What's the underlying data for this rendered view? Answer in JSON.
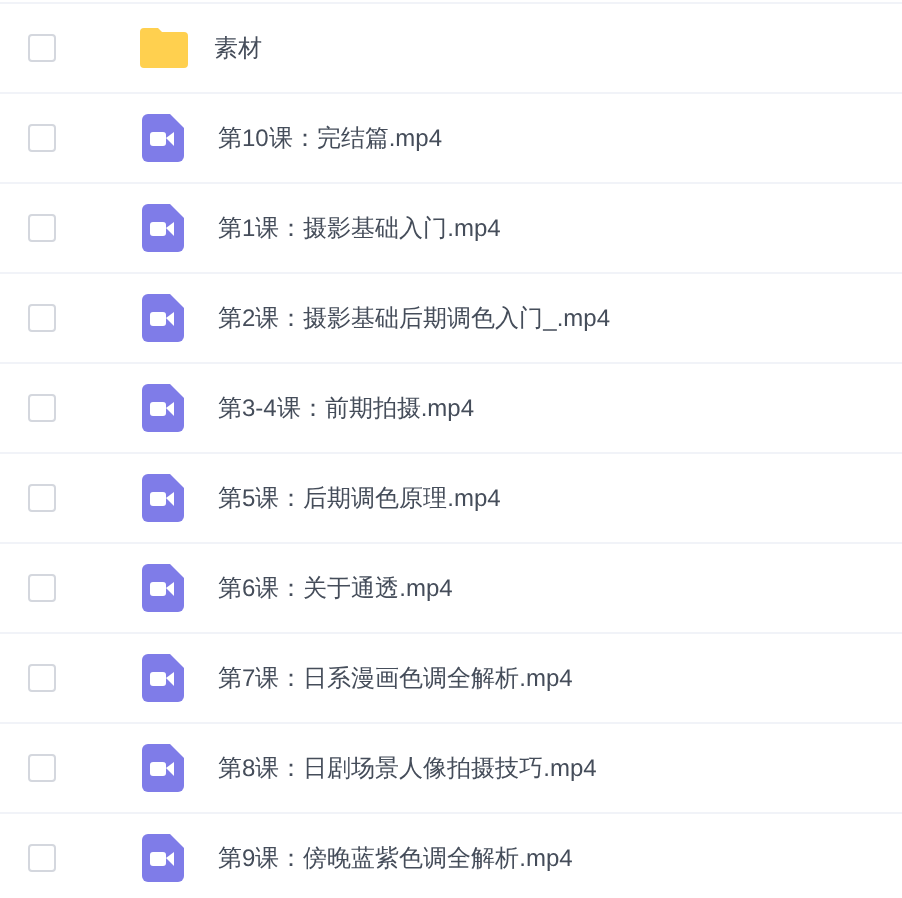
{
  "files": [
    {
      "kind": "folder",
      "name": "素材",
      "checked": false
    },
    {
      "kind": "video",
      "name": "第10课：完结篇.mp4",
      "checked": false
    },
    {
      "kind": "video",
      "name": "第1课：摄影基础入门.mp4",
      "checked": false
    },
    {
      "kind": "video",
      "name": "第2课：摄影基础后期调色入门_.mp4",
      "checked": false
    },
    {
      "kind": "video",
      "name": "第3-4课：前期拍摄.mp4",
      "checked": false
    },
    {
      "kind": "video",
      "name": "第5课：后期调色原理.mp4",
      "checked": false
    },
    {
      "kind": "video",
      "name": "第6课：关于通透.mp4",
      "checked": false
    },
    {
      "kind": "video",
      "name": "第7课：日系漫画色调全解析.mp4",
      "checked": false
    },
    {
      "kind": "video",
      "name": "第8课：日剧场景人像拍摄技巧.mp4",
      "checked": false
    },
    {
      "kind": "video",
      "name": "第9课：傍晚蓝紫色调全解析.mp4",
      "checked": false
    }
  ]
}
